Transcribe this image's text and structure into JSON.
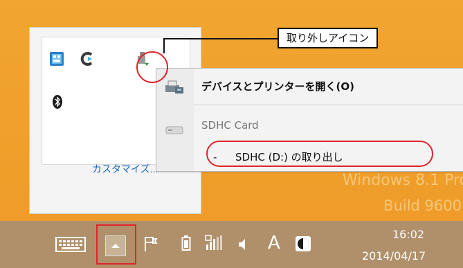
{
  "desktop": {
    "watermark_line1": "Windows 8.1 Pro",
    "watermark_line2": "Build 9600"
  },
  "tray_popup": {
    "icons": [
      "exchange-icon",
      "c-logo-icon",
      "usb-eject-icon",
      "bluetooth-icon"
    ],
    "customize_link": "カスタマイズ..."
  },
  "callout": {
    "label": "取り外しアイコン"
  },
  "context_menu": {
    "items": [
      {
        "label": "デバイスとプリンターを開く(O)",
        "icon": "printer-icon"
      },
      {
        "label": "SDHC Card",
        "icon": "drive-icon"
      },
      {
        "dash": "-",
        "label": "SDHC (D:) の取り出し"
      }
    ]
  },
  "taskbar": {
    "ime_label": "A",
    "clock_time": "16:02",
    "clock_date": "2014/04/17"
  },
  "colors": {
    "highlight": "#e0242b",
    "desktop": "#f0a02c",
    "link": "#1565c0"
  }
}
